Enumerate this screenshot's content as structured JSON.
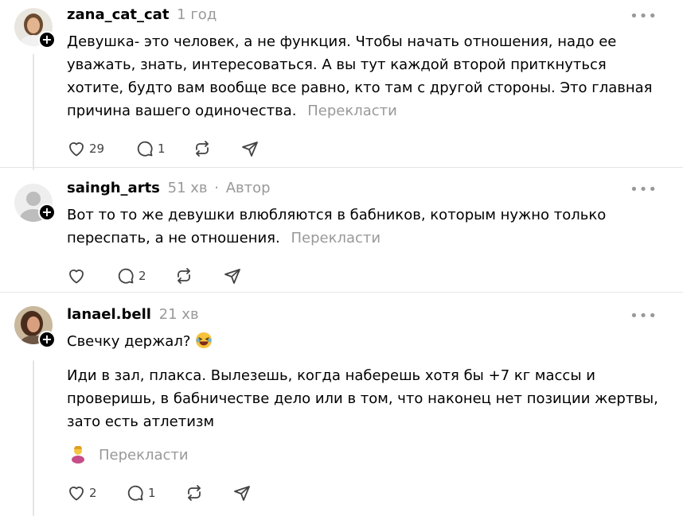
{
  "posts": [
    {
      "username": "zana_cat_cat",
      "time": "1 год",
      "author_tag": "",
      "text": "Девушка- это человек, а не функция. Чтобы начать отношения, надо ее уважать, знать, интересоваться. А вы тут каждой второй приткнуться хотите, будто вам вообще все равно, кто там с другой стороны. Это главная причина вашего одиночества.",
      "translate": "Перекласти",
      "likes": "29",
      "replies": "1",
      "reposts": "",
      "more": "•••"
    },
    {
      "username": "saingh_arts",
      "time": "51 хв",
      "separator": "·",
      "author_tag": "Автор",
      "text": "Вот то то же девушки влюбляются в бабников, которым нужно только переспать, а не отношения.",
      "translate": "Перекласти",
      "likes": "",
      "replies": "2",
      "reposts": "",
      "more": "•••"
    },
    {
      "username": "lanael.bell",
      "time": "21 хв",
      "author_tag": "",
      "text_line1": "Свечку держал?",
      "emoji": "laughing-face",
      "text": "Иди в зал, плакса. Вылезешь, когда наберешь хотя бы +7 кг массы и проверишь, в бабничестве дело или в том, что наконец нет позиции жертвы, зато есть атлетизм",
      "translate": "Перекласти",
      "likes": "2",
      "replies": "1",
      "reposts": "",
      "more": "•••"
    }
  ],
  "colors": {
    "text": "#000000",
    "muted": "#999999",
    "icon": "#424242",
    "divider": "#e5e5e5"
  }
}
